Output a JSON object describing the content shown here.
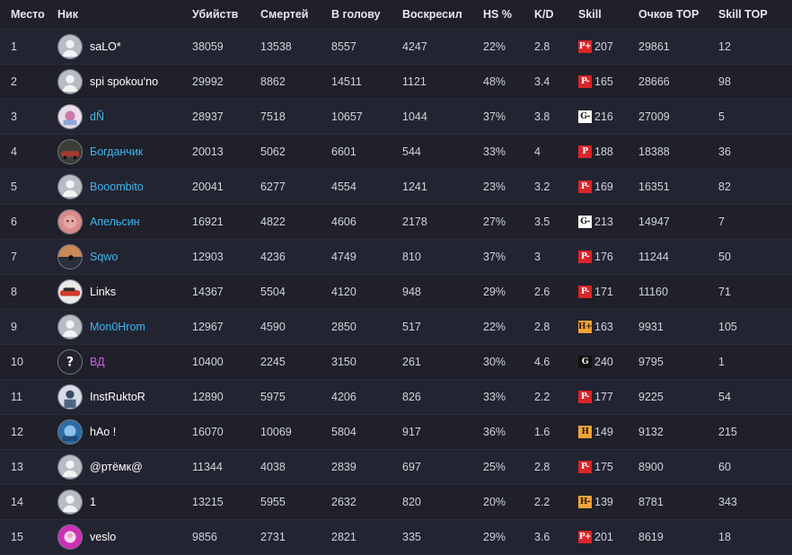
{
  "colors": {
    "background": "#1f2029",
    "row_alt": "#232431",
    "text": "#d2d4db",
    "link_blue": "#3fb6f0",
    "purple": "#d060e6",
    "white": "#ffffff"
  },
  "headers": {
    "rank": "Место",
    "nick": "Ник",
    "kills": "Убийств",
    "deaths": "Смертей",
    "headshots": "В голову",
    "revived": "Воскресил",
    "hs_percent": "HS %",
    "kd": "K/D",
    "skill": "Skill",
    "points_top": "Очков TOP",
    "skill_top": "Skill TOP"
  },
  "rows": [
    {
      "rank": "1",
      "nick": "saLO*",
      "nick_color": "white",
      "avatar": "default-avatar",
      "kills": "38059",
      "deaths": "13538",
      "headshots": "8557",
      "revived": "4247",
      "hs_percent": "22%",
      "kd": "2.8",
      "skill_badge": "P+",
      "badge_style": "red",
      "skill": "207",
      "points_top": "29861",
      "skill_top": "12"
    },
    {
      "rank": "2",
      "nick": "spi spokou'no",
      "nick_color": "white",
      "avatar": "default-avatar",
      "kills": "29992",
      "deaths": "8862",
      "headshots": "14511",
      "revived": "1121",
      "hs_percent": "48%",
      "kd": "3.4",
      "skill_badge": "P-",
      "badge_style": "red",
      "skill": "165",
      "points_top": "28666",
      "skill_top": "98"
    },
    {
      "rank": "3",
      "nick": "dÑ",
      "nick_color": "blue",
      "avatar": "photo-avatar-pink",
      "kills": "28937",
      "deaths": "7518",
      "headshots": "10657",
      "revived": "1044",
      "hs_percent": "37%",
      "kd": "3.8",
      "skill_badge": "G-",
      "badge_style": "dark",
      "skill": "216",
      "points_top": "27009",
      "skill_top": "5"
    },
    {
      "rank": "4",
      "nick": "Богданчик",
      "nick_color": "blue",
      "avatar": "photo-avatar-car",
      "kills": "20013",
      "deaths": "5062",
      "headshots": "6601",
      "revived": "544",
      "hs_percent": "33%",
      "kd": "4",
      "skill_badge": "P",
      "badge_style": "red",
      "skill": "188",
      "points_top": "18388",
      "skill_top": "36"
    },
    {
      "rank": "5",
      "nick": "Booombito",
      "nick_color": "blue",
      "avatar": "default-avatar",
      "kills": "20041",
      "deaths": "6277",
      "headshots": "4554",
      "revived": "1241",
      "hs_percent": "23%",
      "kd": "3.2",
      "skill_badge": "P-",
      "badge_style": "red",
      "skill": "169",
      "points_top": "16351",
      "skill_top": "82"
    },
    {
      "rank": "6",
      "nick": "Апельсин",
      "nick_color": "blue",
      "avatar": "photo-avatar-face",
      "kills": "16921",
      "deaths": "4822",
      "headshots": "4606",
      "revived": "2178",
      "hs_percent": "27%",
      "kd": "3.5",
      "skill_badge": "G-",
      "badge_style": "dark",
      "skill": "213",
      "points_top": "14947",
      "skill_top": "7"
    },
    {
      "rank": "7",
      "nick": "Sqwo",
      "nick_color": "blue",
      "avatar": "photo-avatar-landscape",
      "kills": "12903",
      "deaths": "4236",
      "headshots": "4749",
      "revived": "810",
      "hs_percent": "37%",
      "kd": "3",
      "skill_badge": "P-",
      "badge_style": "red",
      "skill": "176",
      "points_top": "11244",
      "skill_top": "50"
    },
    {
      "rank": "8",
      "nick": "Links",
      "nick_color": "white",
      "avatar": "photo-avatar-car2",
      "kills": "14367",
      "deaths": "5504",
      "headshots": "4120",
      "revived": "948",
      "hs_percent": "29%",
      "kd": "2.6",
      "skill_badge": "P-",
      "badge_style": "red",
      "skill": "171",
      "points_top": "11160",
      "skill_top": "71"
    },
    {
      "rank": "9",
      "nick": "Mon0Hrom",
      "nick_color": "blue",
      "avatar": "default-avatar",
      "kills": "12967",
      "deaths": "4590",
      "headshots": "2850",
      "revived": "517",
      "hs_percent": "22%",
      "kd": "2.8",
      "skill_badge": "H+",
      "badge_style": "orange",
      "skill": "163",
      "points_top": "9931",
      "skill_top": "105"
    },
    {
      "rank": "10",
      "nick": "ВД",
      "nick_color": "purple",
      "avatar": "question-avatar",
      "kills": "10400",
      "deaths": "2245",
      "headshots": "3150",
      "revived": "261",
      "hs_percent": "30%",
      "kd": "4.6",
      "skill_badge": "G",
      "badge_style": "black",
      "skill": "240",
      "points_top": "9795",
      "skill_top": "1"
    },
    {
      "rank": "11",
      "nick": "InstRuktoR",
      "nick_color": "white",
      "avatar": "photo-avatar-person",
      "kills": "12890",
      "deaths": "5975",
      "headshots": "4206",
      "revived": "826",
      "hs_percent": "33%",
      "kd": "2.2",
      "skill_badge": "P-",
      "badge_style": "red",
      "skill": "177",
      "points_top": "9225",
      "skill_top": "54"
    },
    {
      "rank": "12",
      "nick": "hAo !",
      "nick_color": "white",
      "avatar": "photo-avatar-blue",
      "kills": "16070",
      "deaths": "10069",
      "headshots": "5804",
      "revived": "917",
      "hs_percent": "36%",
      "kd": "1.6",
      "skill_badge": "H",
      "badge_style": "orange",
      "skill": "149",
      "points_top": "9132",
      "skill_top": "215"
    },
    {
      "rank": "13",
      "nick": "@ртёмк@",
      "nick_color": "white",
      "avatar": "default-avatar",
      "kills": "11344",
      "deaths": "4038",
      "headshots": "2839",
      "revived": "697",
      "hs_percent": "25%",
      "kd": "2.8",
      "skill_badge": "P-",
      "badge_style": "red",
      "skill": "175",
      "points_top": "8900",
      "skill_top": "60"
    },
    {
      "rank": "14",
      "nick": "1",
      "nick_color": "white",
      "avatar": "default-avatar",
      "kills": "13215",
      "deaths": "5955",
      "headshots": "2632",
      "revived": "820",
      "hs_percent": "20%",
      "kd": "2.2",
      "skill_badge": "H-",
      "badge_style": "orange",
      "skill": "139",
      "points_top": "8781",
      "skill_top": "343"
    },
    {
      "rank": "15",
      "nick": "veslo",
      "nick_color": "white",
      "avatar": "photo-avatar-magenta",
      "kills": "9856",
      "deaths": "2731",
      "headshots": "2821",
      "revived": "335",
      "hs_percent": "29%",
      "kd": "3.6",
      "skill_badge": "P+",
      "badge_style": "red",
      "skill": "201",
      "points_top": "8619",
      "skill_top": "18"
    }
  ]
}
